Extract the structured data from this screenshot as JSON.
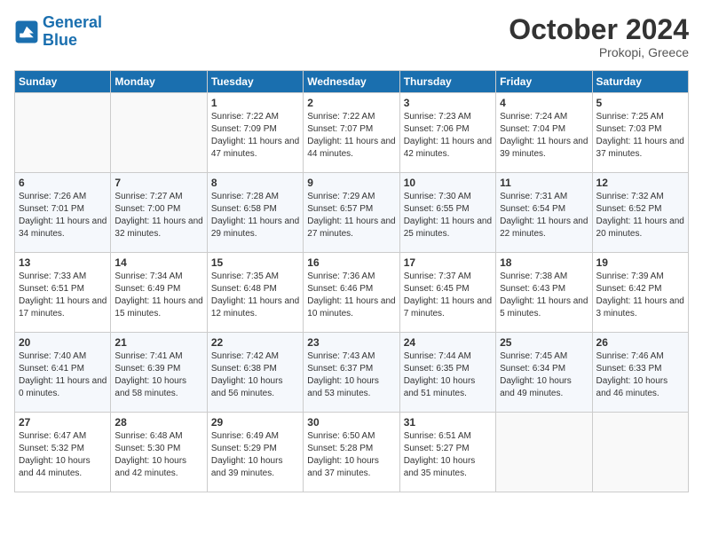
{
  "header": {
    "logo_line1": "General",
    "logo_line2": "Blue",
    "month": "October 2024",
    "location": "Prokopi, Greece"
  },
  "weekdays": [
    "Sunday",
    "Monday",
    "Tuesday",
    "Wednesday",
    "Thursday",
    "Friday",
    "Saturday"
  ],
  "weeks": [
    [
      {
        "day": "",
        "info": ""
      },
      {
        "day": "",
        "info": ""
      },
      {
        "day": "1",
        "info": "Sunrise: 7:22 AM\nSunset: 7:09 PM\nDaylight: 11 hours and 47 minutes."
      },
      {
        "day": "2",
        "info": "Sunrise: 7:22 AM\nSunset: 7:07 PM\nDaylight: 11 hours and 44 minutes."
      },
      {
        "day": "3",
        "info": "Sunrise: 7:23 AM\nSunset: 7:06 PM\nDaylight: 11 hours and 42 minutes."
      },
      {
        "day": "4",
        "info": "Sunrise: 7:24 AM\nSunset: 7:04 PM\nDaylight: 11 hours and 39 minutes."
      },
      {
        "day": "5",
        "info": "Sunrise: 7:25 AM\nSunset: 7:03 PM\nDaylight: 11 hours and 37 minutes."
      }
    ],
    [
      {
        "day": "6",
        "info": "Sunrise: 7:26 AM\nSunset: 7:01 PM\nDaylight: 11 hours and 34 minutes."
      },
      {
        "day": "7",
        "info": "Sunrise: 7:27 AM\nSunset: 7:00 PM\nDaylight: 11 hours and 32 minutes."
      },
      {
        "day": "8",
        "info": "Sunrise: 7:28 AM\nSunset: 6:58 PM\nDaylight: 11 hours and 29 minutes."
      },
      {
        "day": "9",
        "info": "Sunrise: 7:29 AM\nSunset: 6:57 PM\nDaylight: 11 hours and 27 minutes."
      },
      {
        "day": "10",
        "info": "Sunrise: 7:30 AM\nSunset: 6:55 PM\nDaylight: 11 hours and 25 minutes."
      },
      {
        "day": "11",
        "info": "Sunrise: 7:31 AM\nSunset: 6:54 PM\nDaylight: 11 hours and 22 minutes."
      },
      {
        "day": "12",
        "info": "Sunrise: 7:32 AM\nSunset: 6:52 PM\nDaylight: 11 hours and 20 minutes."
      }
    ],
    [
      {
        "day": "13",
        "info": "Sunrise: 7:33 AM\nSunset: 6:51 PM\nDaylight: 11 hours and 17 minutes."
      },
      {
        "day": "14",
        "info": "Sunrise: 7:34 AM\nSunset: 6:49 PM\nDaylight: 11 hours and 15 minutes."
      },
      {
        "day": "15",
        "info": "Sunrise: 7:35 AM\nSunset: 6:48 PM\nDaylight: 11 hours and 12 minutes."
      },
      {
        "day": "16",
        "info": "Sunrise: 7:36 AM\nSunset: 6:46 PM\nDaylight: 11 hours and 10 minutes."
      },
      {
        "day": "17",
        "info": "Sunrise: 7:37 AM\nSunset: 6:45 PM\nDaylight: 11 hours and 7 minutes."
      },
      {
        "day": "18",
        "info": "Sunrise: 7:38 AM\nSunset: 6:43 PM\nDaylight: 11 hours and 5 minutes."
      },
      {
        "day": "19",
        "info": "Sunrise: 7:39 AM\nSunset: 6:42 PM\nDaylight: 11 hours and 3 minutes."
      }
    ],
    [
      {
        "day": "20",
        "info": "Sunrise: 7:40 AM\nSunset: 6:41 PM\nDaylight: 11 hours and 0 minutes."
      },
      {
        "day": "21",
        "info": "Sunrise: 7:41 AM\nSunset: 6:39 PM\nDaylight: 10 hours and 58 minutes."
      },
      {
        "day": "22",
        "info": "Sunrise: 7:42 AM\nSunset: 6:38 PM\nDaylight: 10 hours and 56 minutes."
      },
      {
        "day": "23",
        "info": "Sunrise: 7:43 AM\nSunset: 6:37 PM\nDaylight: 10 hours and 53 minutes."
      },
      {
        "day": "24",
        "info": "Sunrise: 7:44 AM\nSunset: 6:35 PM\nDaylight: 10 hours and 51 minutes."
      },
      {
        "day": "25",
        "info": "Sunrise: 7:45 AM\nSunset: 6:34 PM\nDaylight: 10 hours and 49 minutes."
      },
      {
        "day": "26",
        "info": "Sunrise: 7:46 AM\nSunset: 6:33 PM\nDaylight: 10 hours and 46 minutes."
      }
    ],
    [
      {
        "day": "27",
        "info": "Sunrise: 6:47 AM\nSunset: 5:32 PM\nDaylight: 10 hours and 44 minutes."
      },
      {
        "day": "28",
        "info": "Sunrise: 6:48 AM\nSunset: 5:30 PM\nDaylight: 10 hours and 42 minutes."
      },
      {
        "day": "29",
        "info": "Sunrise: 6:49 AM\nSunset: 5:29 PM\nDaylight: 10 hours and 39 minutes."
      },
      {
        "day": "30",
        "info": "Sunrise: 6:50 AM\nSunset: 5:28 PM\nDaylight: 10 hours and 37 minutes."
      },
      {
        "day": "31",
        "info": "Sunrise: 6:51 AM\nSunset: 5:27 PM\nDaylight: 10 hours and 35 minutes."
      },
      {
        "day": "",
        "info": ""
      },
      {
        "day": "",
        "info": ""
      }
    ]
  ]
}
